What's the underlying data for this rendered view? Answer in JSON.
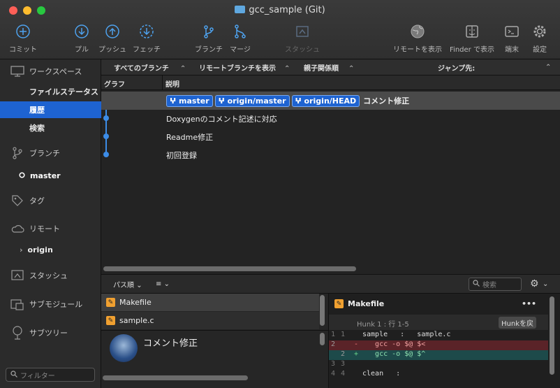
{
  "window": {
    "title": "gcc_sample (Git)"
  },
  "toolbar": [
    {
      "id": "commit",
      "label": "コミット",
      "icon": "plus-circle-icon"
    },
    {
      "id": "pull",
      "label": "プル",
      "icon": "arrow-down-circle-icon"
    },
    {
      "id": "push",
      "label": "プッシュ",
      "icon": "arrow-up-circle-icon"
    },
    {
      "id": "fetch",
      "label": "フェッチ",
      "icon": "fetch-icon"
    },
    {
      "id": "branch",
      "label": "ブランチ",
      "icon": "branch-icon"
    },
    {
      "id": "merge",
      "label": "マージ",
      "icon": "merge-icon"
    },
    {
      "id": "stash",
      "label": "スタッシュ",
      "icon": "stash-icon"
    },
    {
      "id": "remote",
      "label": "リモートを表示",
      "icon": "globe-icon"
    },
    {
      "id": "finder",
      "label": "Finder で表示",
      "icon": "finder-icon"
    },
    {
      "id": "terminal",
      "label": "端末",
      "icon": "terminal-icon"
    },
    {
      "id": "settings",
      "label": "設定",
      "icon": "gear-icon"
    }
  ],
  "sidebar": {
    "workspace": "ワークスペース",
    "file_status": "ファイルステータス",
    "history": "履歴",
    "search": "検索",
    "branches": "ブランチ",
    "branch_master": "master",
    "tags": "タグ",
    "remotes": "リモート",
    "remote_origin": "origin",
    "stash": "スタッシュ",
    "submodule": "サブモジュール",
    "subtree": "サブツリー",
    "filter_placeholder": "フィルター"
  },
  "filterbar": {
    "all_branches": "すべてのブランチ",
    "show_remote": "リモートブランチを表示",
    "order": "親子関係順",
    "jump": "ジャンプ先:"
  },
  "columns": {
    "graph": "グラフ",
    "description": "説明"
  },
  "commits": [
    {
      "refs": [
        "master",
        "origin/master",
        "origin/HEAD"
      ],
      "message": "コメント修正"
    },
    {
      "refs": [],
      "message": "Doxygenのコメント記述に対応"
    },
    {
      "refs": [],
      "message": "Readme修正"
    },
    {
      "refs": [],
      "message": "初回登録"
    }
  ],
  "lower": {
    "sort": "パス順",
    "search_placeholder": "検索",
    "files": [
      "Makefile",
      "sample.c"
    ],
    "commit_message": "コメント修正"
  },
  "diff": {
    "file": "Makefile",
    "more": "•••",
    "hunk": "Hunk 1 : 行 1-5",
    "revert_button": "Hunkを戻",
    "lines": [
      {
        "old": "1",
        "new": "1",
        "sign": " ",
        "text": "sample   :   sample.c",
        "type": "ctx"
      },
      {
        "old": "2",
        "new": "",
        "sign": "-",
        "text": "   gcc -o $@ $<",
        "type": "del"
      },
      {
        "old": "",
        "new": "2",
        "sign": "+",
        "text": "   gcc -o $@ $^",
        "type": "add"
      },
      {
        "old": "3",
        "new": "3",
        "sign": " ",
        "text": "",
        "type": "ctx"
      },
      {
        "old": "4",
        "new": "4",
        "sign": " ",
        "text": "clean   :",
        "type": "ctx"
      }
    ]
  },
  "colors": {
    "accent": "#1e63d1",
    "del_bg": "#5a2328",
    "add_bg": "#1d4a4a",
    "file_icon": "#f0a030"
  }
}
